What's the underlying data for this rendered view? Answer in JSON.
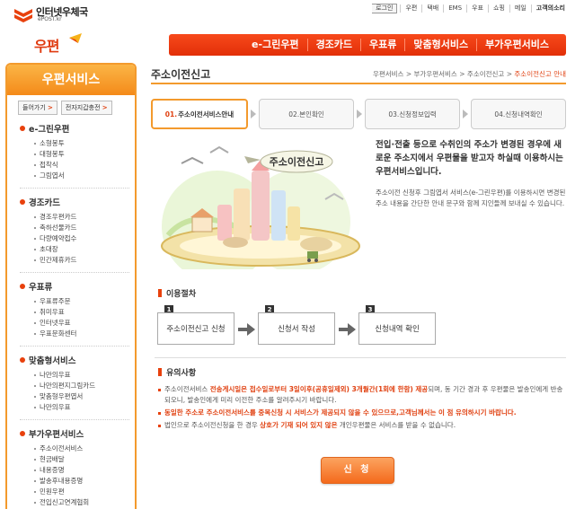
{
  "logo": {
    "name": "인터넷우체국",
    "sub": "ePOST.kr"
  },
  "topnav": {
    "login": "로그인",
    "links": [
      "우편",
      "택배",
      "EMS",
      "우표",
      "쇼핑",
      "메일"
    ],
    "customer": "고객의소리"
  },
  "brand": {
    "label": "우편"
  },
  "mainnav": [
    "e-그린우편",
    "경조카드",
    "우표류",
    "맞춤형서비스",
    "부가우편서비스"
  ],
  "sidebar": {
    "title": "우편서비스",
    "buttons": [
      {
        "label": "들어가기",
        "arrow": ">"
      },
      {
        "label": "전자지갑충전",
        "arrow": ">"
      }
    ],
    "sections": [
      {
        "title": "e-그린우편",
        "items": [
          "소형봉투",
          "대형봉투",
          "접착식",
          "그림엽서"
        ]
      },
      {
        "title": "경조카드",
        "items": [
          "경조우편카드",
          "축하선물카드",
          "다량예약접수",
          "초대장",
          "민간제휴카드"
        ]
      },
      {
        "title": "우표류",
        "items": [
          "우표류주문",
          "취미우표",
          "인터넷우표",
          "우표문화센터"
        ]
      },
      {
        "title": "맞춤형서비스",
        "items": [
          "나만의우표",
          "나만의편지그림카드",
          "맞춤형우편엽서",
          "나만의우표"
        ]
      },
      {
        "title": "부가우편서비스",
        "items": [
          "주소이전서비스",
          "현금배달",
          "내용증명",
          "발송후내용증명",
          "민원우편",
          "전입신고연계협회"
        ]
      }
    ]
  },
  "page": {
    "title": "주소이전신고",
    "breadcrumb": [
      "우편서비스",
      "부가우편서비스",
      "주소이전신고",
      "주소이전신고 안내"
    ],
    "breadcrumb_sep": ">"
  },
  "steps": [
    {
      "num": "01.",
      "label": "주소이전서비스안내"
    },
    {
      "num": "02.",
      "label": "본인확인"
    },
    {
      "num": "03.",
      "label": "신청정보입력"
    },
    {
      "num": "04.",
      "label": "신청내역확인"
    }
  ],
  "illustration": {
    "banner": "주소이전신고"
  },
  "intro": {
    "headline": "전입·전출 등으로 수취인의 주소가 변경된 경우에 새로운 주소지에서 우편물을 받고자 하실때 이용하시는 우편서비스입니다.",
    "body": "주소이전 신청후 그림엽서 서비스(e-그린우편)를 이용하시면 변경된 주소 내용을 간단한 안내 문구와 함께 지인들께 보내실 수 있습니다."
  },
  "procedure": {
    "title": "이용절차",
    "steps": [
      {
        "num": "1",
        "label": "주소이전신고 신청"
      },
      {
        "num": "2",
        "label": "신청서 작성"
      },
      {
        "num": "3",
        "label": "신청내역 확인"
      }
    ]
  },
  "notes": {
    "title": "유의사항",
    "n1_a": "주소이전서비스 ",
    "n1_b": "전송게시일은 접수일로부터 3일이후(공휴일제외) 3개월간(1회에 한함) 제공",
    "n1_c": "되며, 동 기간 경과 후 우편물은 발송인에게 반송되오니, 발송인에게 미리 이전한 주소를 알려주시기 바랍니다.",
    "n2": "동일한 주소로 주소이전서비스를 중복신청 시 서비스가 제공되지 않을 수 있으므로,고객님께서는 이 점 유의하시기 바랍니다.",
    "n3_a": "법인으로 주소이전신청을 한 경우 ",
    "n3_b": "상호가 기재 되어 있지 않은",
    "n3_c": " 개인우편물은 서비스를 받을 수 없습니다."
  },
  "apply_button": "신 청",
  "colors": {
    "accent": "#e8410d",
    "orange": "#f39a2d",
    "nav": "#f2400f"
  }
}
